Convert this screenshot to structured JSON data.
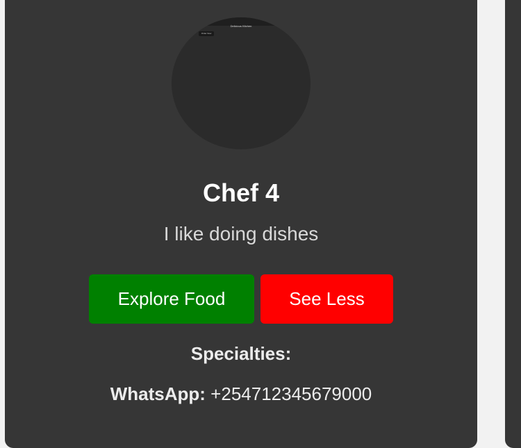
{
  "card": {
    "avatar": {
      "title": "Delicious Kitchen",
      "button_label": "Order Now"
    },
    "name": "Chef 4",
    "bio": "I like doing dishes",
    "buttons": {
      "explore": "Explore Food",
      "see_less": "See Less"
    },
    "specialties_label": "Specialties:",
    "whatsapp": {
      "label": "WhatsApp:",
      "number": "+254712345679000"
    }
  },
  "colors": {
    "page_background": "#f2f2f2",
    "card_background": "#363636",
    "explore_button": "#008000",
    "see_less_button": "#ff0000"
  }
}
